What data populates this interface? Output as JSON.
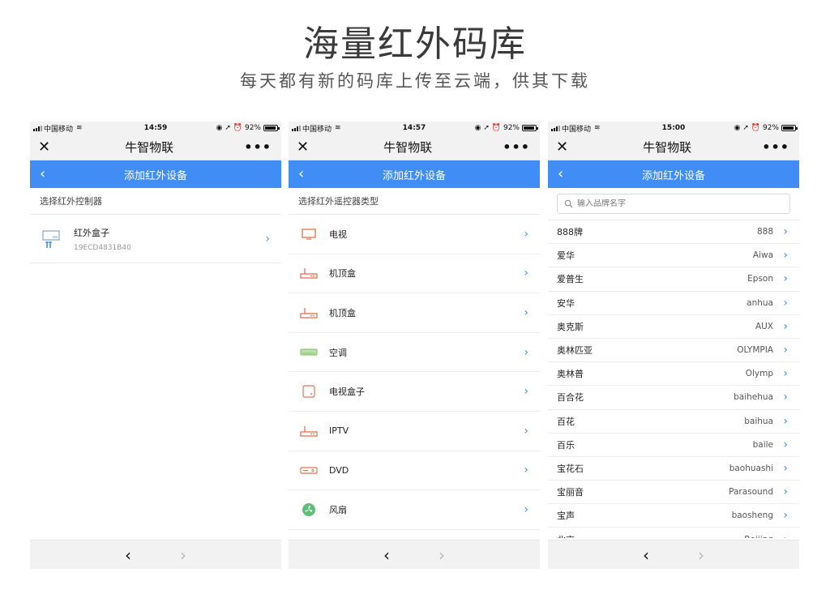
{
  "header": {
    "title": "海量红外码库",
    "subtitle": "每天都有新的码库上传至云端，供其下载"
  },
  "common": {
    "carrier": "中国移动",
    "battery": "92%",
    "app_title": "牛智物联",
    "page_title": "添加红外设备",
    "close_glyph": "✕",
    "more_glyph": "•••",
    "back_glyph": "‹",
    "forward_glyph": "›",
    "chevron": "›",
    "accent_color": "#3f8df5"
  },
  "screen1": {
    "time": "14:59",
    "section_label": "选择红外控制器",
    "device": {
      "name": "红外盒子",
      "id": "19ECD4831B40"
    }
  },
  "screen2": {
    "time": "14:57",
    "section_label": "选择红外遥控器类型",
    "types": [
      {
        "label": "电视",
        "icon": "tv-icon"
      },
      {
        "label": "机顶盒",
        "icon": "settop-box-icon"
      },
      {
        "label": "机顶盒",
        "icon": "settop-box-icon"
      },
      {
        "label": "空调",
        "icon": "air-conditioner-icon"
      },
      {
        "label": "电视盒子",
        "icon": "tv-box-icon"
      },
      {
        "label": "IPTV",
        "icon": "iptv-icon"
      },
      {
        "label": "DVD",
        "icon": "dvd-icon"
      },
      {
        "label": "风扇",
        "icon": "fan-icon"
      }
    ]
  },
  "screen3": {
    "time": "15:00",
    "search_placeholder": "输入品牌名字",
    "brands": [
      {
        "cn": "888牌",
        "en": "888"
      },
      {
        "cn": "爱华",
        "en": "Aiwa"
      },
      {
        "cn": "爱普生",
        "en": "Epson"
      },
      {
        "cn": "安华",
        "en": "anhua"
      },
      {
        "cn": "奥克斯",
        "en": "AUX"
      },
      {
        "cn": "奥林匹亚",
        "en": "OLYMPIA"
      },
      {
        "cn": "奥林普",
        "en": "Olymp"
      },
      {
        "cn": "百合花",
        "en": "baihehua"
      },
      {
        "cn": "百花",
        "en": "baihua"
      },
      {
        "cn": "百乐",
        "en": "baile"
      },
      {
        "cn": "宝花石",
        "en": "baohuashi"
      },
      {
        "cn": "宝丽音",
        "en": "Parasound"
      },
      {
        "cn": "宝声",
        "en": "baosheng"
      },
      {
        "cn": "北京",
        "en": "Beijing"
      }
    ]
  }
}
